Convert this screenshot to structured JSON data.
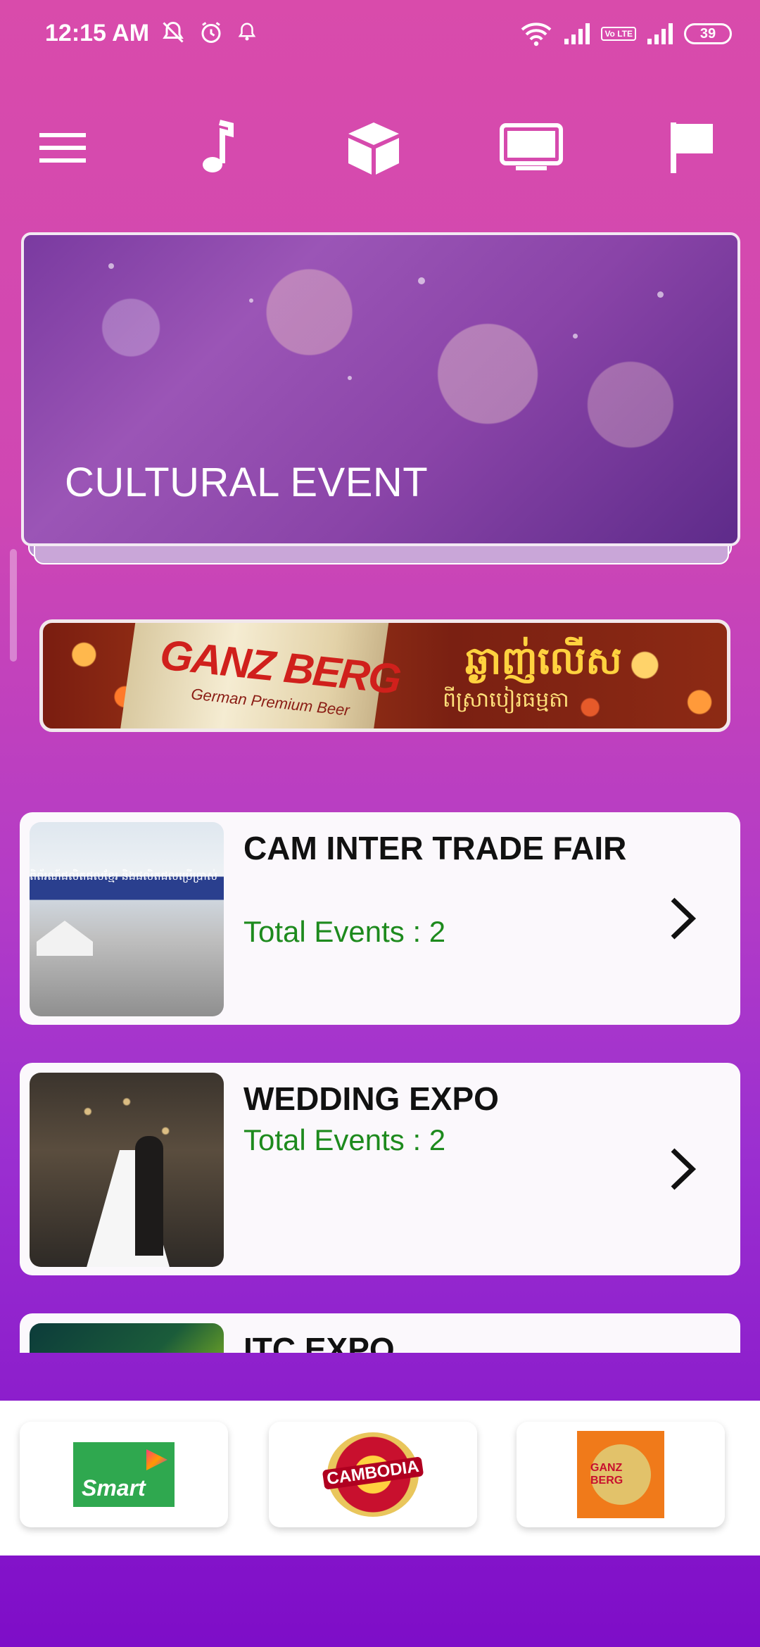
{
  "status_bar": {
    "time": "12:15 AM",
    "battery": "39",
    "network_badge": "Vo LTE",
    "icons": [
      "mute-icon",
      "alarm-icon",
      "notification-icon",
      "wifi-icon",
      "signal-icon",
      "signal-icon"
    ]
  },
  "top_nav": {
    "items": [
      "menu-icon",
      "music-icon",
      "cube-icon",
      "tv-icon",
      "flag-icon"
    ]
  },
  "hero": {
    "title": "CULTURAL EVENT"
  },
  "ad_banner": {
    "brand": "GANZ BERG",
    "brand_sub": "German Premium Beer",
    "headline_khmer": "ឆ្ងាញ់លើស",
    "sub_khmer": "ពីស្រាបៀរធម្មតា"
  },
  "categories": [
    {
      "title": "CAM INTER TRADE FAIR",
      "subtitle": "Total Events : 2",
      "thumb_text": "ពិព័រណ៍ផលិតផលខ្មែរ និងផលិតផលប្រើប្រាស់"
    },
    {
      "title": "WEDDING EXPO",
      "subtitle": "Total Events : 2"
    },
    {
      "title": "ITC EXPO"
    }
  ],
  "sponsors": {
    "smart": "Smart",
    "cambodia": "CAMBODIA",
    "ganzberg": "GANZ BERG"
  },
  "colors": {
    "accent_green": "#1d8a1d",
    "bg_top": "#d94bab",
    "bg_bottom": "#7e0dc8"
  }
}
